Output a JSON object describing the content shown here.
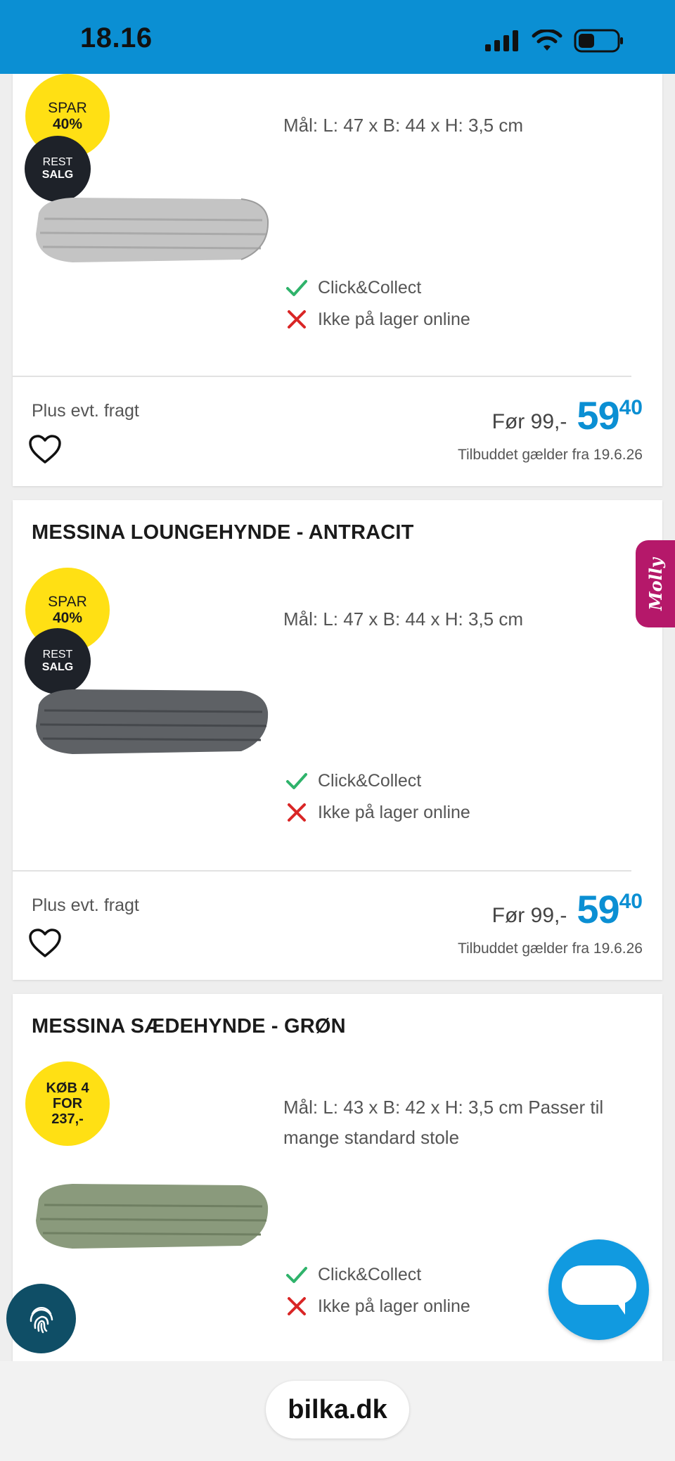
{
  "status_bar": {
    "time": "18.16"
  },
  "products": [
    {
      "title": "",
      "badge_type": "spar",
      "spar_line1": "SPAR",
      "spar_line2": "40%",
      "rest_line1": "REST",
      "rest_line2": "SALG",
      "dimensions": "Mål: L: 47 x B: 44 x H: 3,5 cm",
      "click_collect": "Click&Collect",
      "stock_status": "Ikke på lager online",
      "freight": "Plus evt. fragt",
      "before_price": "Før 99,-",
      "price_main": "59",
      "price_decimals": "40",
      "offer_note": "Tilbuddet gælder fra 19.6.26",
      "cushion_color": "#bdbdbd"
    },
    {
      "title": "MESSINA LOUNGEHYNDE - ANTRACIT",
      "badge_type": "spar",
      "spar_line1": "SPAR",
      "spar_line2": "40%",
      "rest_line1": "REST",
      "rest_line2": "SALG",
      "dimensions": "Mål: L: 47 x B: 44 x H: 3,5 cm",
      "click_collect": "Click&Collect",
      "stock_status": "Ikke på lager online",
      "freight": "Plus evt. fragt",
      "before_price": "Før 99,-",
      "price_main": "59",
      "price_decimals": "40",
      "offer_note": "Tilbuddet gælder fra 19.6.26",
      "cushion_color": "#5e6165"
    },
    {
      "title": "MESSINA SÆDEHYNDE - GRØN",
      "badge_type": "kob",
      "kob_line1": "KØB 4",
      "kob_line2": "FOR",
      "kob_line3": "237,-",
      "dimensions": "Mål: L: 43 x B: 42 x H: 3,5 cm Passer til mange standard stole",
      "click_collect": "Click&Collect",
      "stock_status": "Ikke på lager online",
      "cushion_color": "#8a9a7c"
    }
  ],
  "molly_tab": {
    "label": "Molly"
  },
  "browser": {
    "url": "bilka.dk"
  },
  "colors": {
    "brand_blue": "#0b8fd3",
    "badge_yellow": "#ffe014",
    "check_green": "#2fb36b",
    "cross_red": "#d92626"
  }
}
